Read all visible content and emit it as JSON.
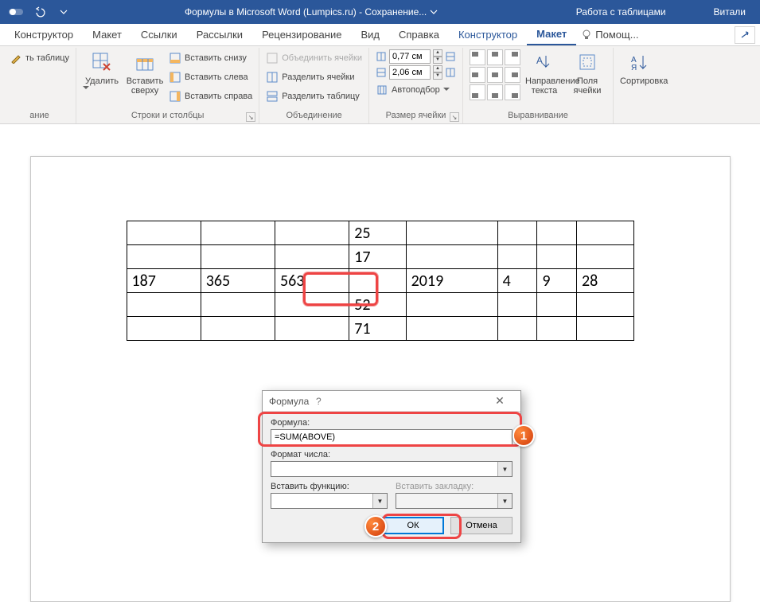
{
  "titlebar": {
    "doc_title": "Формулы в Microsoft Word (Lumpics.ru)  -  Сохранение...",
    "context_title": "Работа с таблицами",
    "user": "Витали"
  },
  "tabs": {
    "constructor": "Конструктор",
    "layout_page": "Макет",
    "references": "Ссылки",
    "mailings": "Рассылки",
    "review": "Рецензирование",
    "view": "Вид",
    "help": "Справка",
    "tbl_constructor": "Конструктор",
    "tbl_layout": "Макет",
    "tell_me": "Помощ..."
  },
  "ribbon": {
    "grp_table_label": "ание",
    "draw_table": "ть таблицу",
    "grp_rowscols_label": "Строки и столбцы",
    "delete": "Удалить",
    "insert_above": "Вставить сверху",
    "insert_below": "Вставить снизу",
    "insert_left": "Вставить слева",
    "insert_right": "Вставить справа",
    "grp_merge_label": "Объединение",
    "merge_cells": "Объединить ячейки",
    "split_cells": "Разделить ячейки",
    "split_table": "Разделить таблицу",
    "grp_cellsize_label": "Размер ячейки",
    "height_value": "0,77 см",
    "width_value": "2,06 см",
    "autofit": "Автоподбор",
    "grp_align_label": "Выравнивание",
    "text_direction": "Направление текста",
    "cell_margins": "Поля ячейки",
    "grp_data_label": "",
    "sort": "Сортировка"
  },
  "table": {
    "rows": [
      [
        "",
        "",
        "",
        "25",
        "",
        "",
        "",
        ""
      ],
      [
        "",
        "",
        "",
        "17",
        "",
        "",
        "",
        ""
      ],
      [
        "187",
        "365",
        "563",
        "",
        "2019",
        "4",
        "9",
        "28"
      ],
      [
        "",
        "",
        "",
        "52",
        "",
        "",
        "",
        ""
      ],
      [
        "",
        "",
        "",
        "71",
        "",
        "",
        "",
        ""
      ]
    ]
  },
  "dialog": {
    "title": "Формула",
    "formula_label": "Формула:",
    "formula_value": "=SUM(ABOVE)",
    "num_format_label": "Формат числа:",
    "num_format_value": "",
    "insert_fn_label": "Вставить функцию:",
    "insert_bm_label": "Вставить закладку:",
    "ok": "ОК",
    "cancel": "Отмена"
  },
  "badges": {
    "one": "1",
    "two": "2"
  }
}
